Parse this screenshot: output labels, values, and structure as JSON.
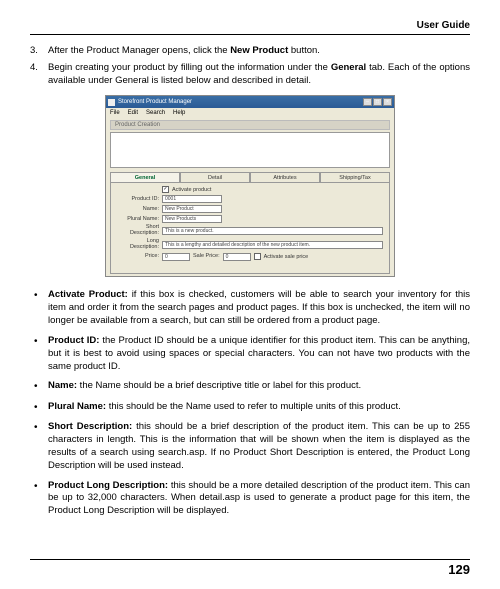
{
  "header": {
    "title": "User Guide"
  },
  "steps": {
    "s3": {
      "num": "3.",
      "pre": "After the Product Manager opens, click the ",
      "bold": "New Product",
      "post": " button."
    },
    "s4": {
      "num": "4.",
      "pre": "Begin creating your product by filling out the information under the ",
      "bold": "General",
      "post": " tab. Each of the options available under General is listed below and described in detail."
    }
  },
  "window": {
    "title": "Storefront Product Manager",
    "menus": {
      "m0": "File",
      "m1": "Edit",
      "m2": "Search",
      "m3": "Help"
    },
    "section": "Product Creation",
    "tabs": {
      "t0": "General",
      "t1": "Detail",
      "t2": "Attributes",
      "t3": "Shipping/Tax"
    },
    "form": {
      "activate_label": "Activate product",
      "product_id": {
        "label": "Product ID:",
        "value": "0001"
      },
      "name": {
        "label": "Name:",
        "value": "New Product"
      },
      "plural": {
        "label": "Plural Name:",
        "value": "New Products"
      },
      "short": {
        "label": "Short Description:",
        "value": "This is a new product."
      },
      "long": {
        "label": "Long Description:",
        "value": "This is a lengthy and detailed description of the new product item."
      },
      "price": {
        "label": "Price:",
        "value": "0"
      },
      "sale_price": {
        "label": "Sale Price:",
        "value": "0"
      },
      "activate_sale": "Activate sale price"
    }
  },
  "bullets": {
    "b0": {
      "bold": "Activate Product:",
      "text": " if this box is checked, customers will be able to search your inventory for this item and order it from the search pages and product pages. If this box is unchecked, the item will no longer be available from a search, but can still be ordered from a product page."
    },
    "b1": {
      "bold": "Product ID:",
      "text": " the Product ID should be a unique identifier for this product item. This can be anything, but it is best to avoid using spaces or special characters. You can not have two products with the same product ID."
    },
    "b2": {
      "bold": "Name:",
      "text": " the Name should be a brief descriptive title or label for this product."
    },
    "b3": {
      "bold": "Plural Name:",
      "text": " this should be the Name used to refer to multiple units of this product."
    },
    "b4": {
      "bold": "Short Description:",
      "text": " this should be a brief description of the product item. This can be up to 255 characters in length. This is the information that will be shown when the item is displayed as the results of a search using search.asp. If no Product Short Description is entered, the Product Long Description will be used instead."
    },
    "b5": {
      "bold": "Product Long Description:",
      "text": " this should be a more detailed description of the product item. This can be up to 32,000 characters. When detail.asp is used to generate a product page for this item, the Product Long Description will be displayed."
    }
  },
  "footer": {
    "page": "129"
  }
}
